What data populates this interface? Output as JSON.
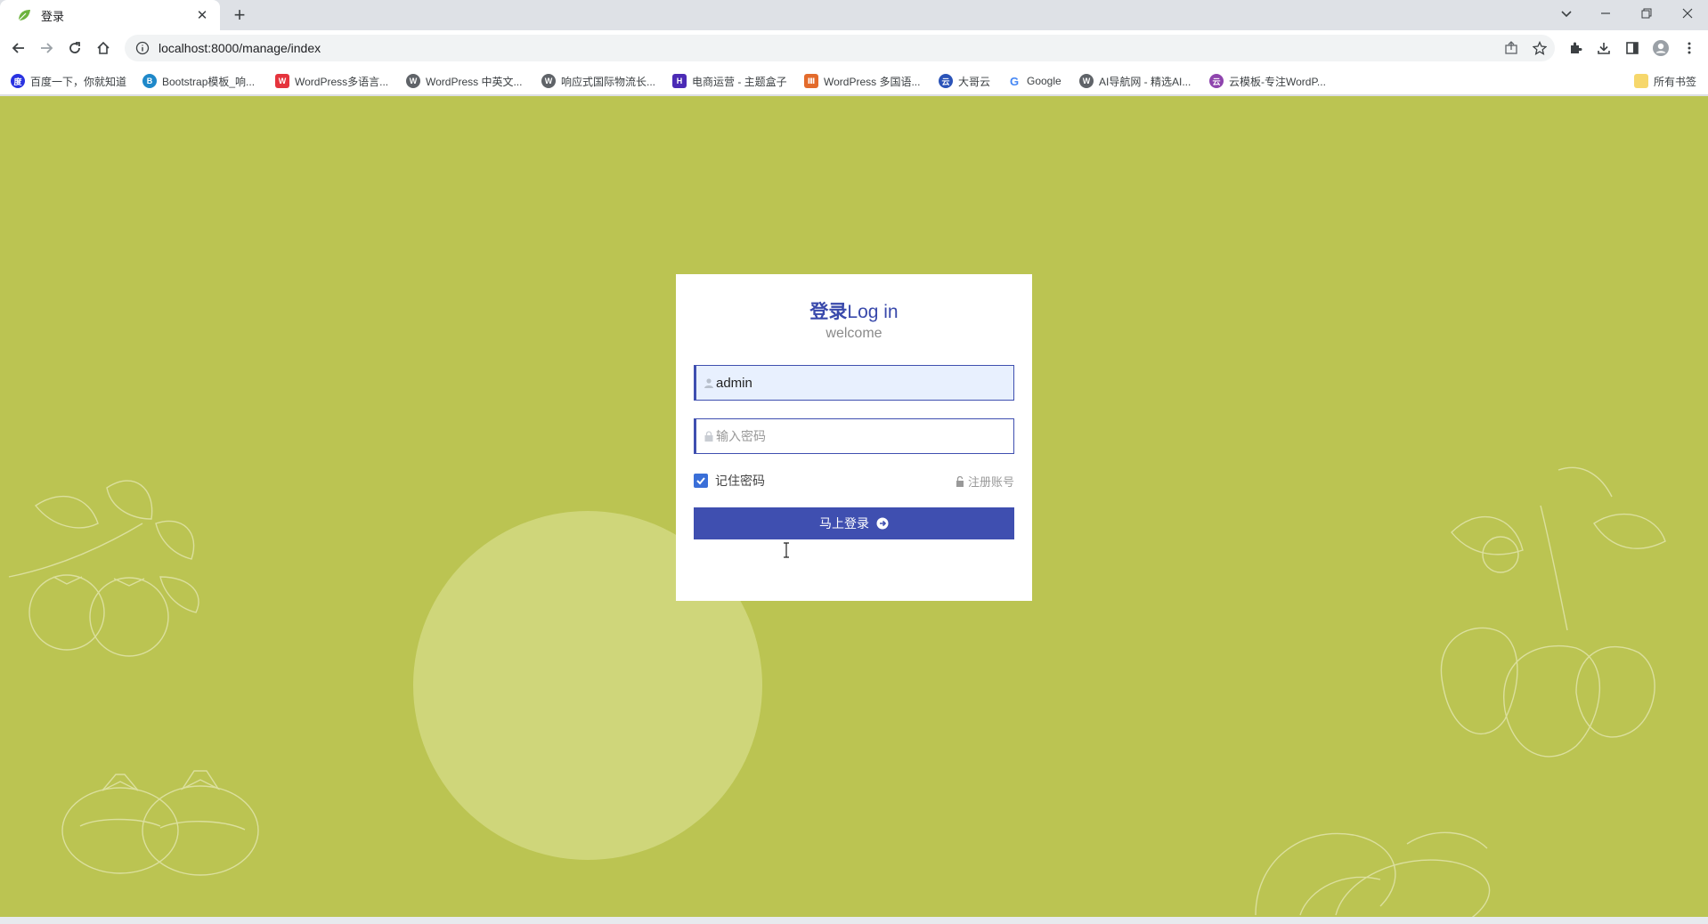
{
  "browser": {
    "tab_title": "登录",
    "url": "localhost:8000/manage/index",
    "bookmarks": [
      {
        "label": "百度一下，你就知道",
        "icon": "baidu-icon",
        "color": "#2932e1"
      },
      {
        "label": "Bootstrap模板_响...",
        "icon": "bootstrap-icon",
        "color": "#1e88c9"
      },
      {
        "label": "WordPress多语言...",
        "icon": "w-red-icon",
        "color": "#e5343d"
      },
      {
        "label": "WordPress 中英文...",
        "icon": "wordpress-icon",
        "color": "#3c4043"
      },
      {
        "label": "响应式国际物流长...",
        "icon": "wordpress-icon",
        "color": "#3c4043"
      },
      {
        "label": "电商运营 - 主题盒子",
        "icon": "theme-box-icon",
        "color": "#4b2bb5"
      },
      {
        "label": "WordPress 多国语...",
        "icon": "bars-icon",
        "color": "#e36b2c"
      },
      {
        "label": "大哥云",
        "icon": "dageyun-icon",
        "color": "#2a53b8"
      },
      {
        "label": "Google",
        "icon": "google-icon",
        "color": "#4285f4"
      },
      {
        "label": "AI导航网 - 精选AI...",
        "icon": "wordpress-icon",
        "color": "#3c4043"
      },
      {
        "label": "云模板-专注WordP...",
        "icon": "yunmoban-icon",
        "color": "#8e44ad"
      }
    ],
    "all_bookmarks_label": "所有书签"
  },
  "login": {
    "title_cn": "登录",
    "title_en": "Log in",
    "subtitle": "welcome",
    "username_value": "admin",
    "password_placeholder": "输入密码",
    "remember_label": "记住密码",
    "remember_checked": true,
    "register_label": "注册账号",
    "submit_label": "马上登录"
  },
  "colors": {
    "page_bg": "#bbc452",
    "circle": "#cfd67a",
    "accent": "#3f4fb0"
  }
}
